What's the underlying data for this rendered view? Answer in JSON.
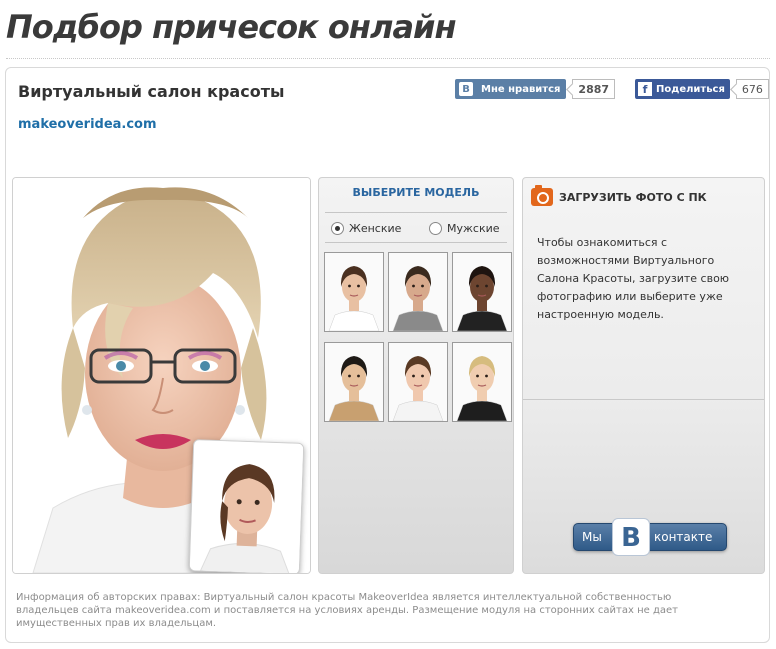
{
  "page": {
    "title": "Подбор причесок онлайн"
  },
  "header": {
    "app_title": "Виртуальный салон красоты",
    "site_link": "makeoveridea.com",
    "vk_like": {
      "logo": "B",
      "label": "Мне нравится",
      "count": "2887"
    },
    "fb_share": {
      "logo": "f",
      "label": "Поделиться",
      "count": "676"
    }
  },
  "model_selector": {
    "heading": "ВЫБЕРИТЕ МОДЕЛЬ",
    "options": [
      {
        "label": "Женские",
        "selected": true
      },
      {
        "label": "Мужские",
        "selected": false
      }
    ],
    "thumbnails": [
      {
        "skin": "#e8c0a2",
        "hair": "#4a3020",
        "clothes": "#ffffff"
      },
      {
        "skin": "#d7a98c",
        "hair": "#3a2a1e",
        "clothes": "#8a8a8a"
      },
      {
        "skin": "#6d4530",
        "hair": "#1e1410",
        "clothes": "#222222"
      },
      {
        "skin": "#e5bf9a",
        "hair": "#1e1a16",
        "clothes": "#c8a070"
      },
      {
        "skin": "#f0c8ae",
        "hair": "#5a3a24",
        "clothes": "#f4f4f4"
      },
      {
        "skin": "#f0cdb0",
        "hair": "#d6bc7e",
        "clothes": "#1e1e1e"
      }
    ]
  },
  "upload": {
    "heading": "ЗАГРУЗИТЬ ФОТО С ПК",
    "icon": "camera-icon",
    "description": "Чтобы ознакомиться с возможностями Виртуального Салона Красоты, загрузите свою фотографию или выберите уже настроенную модель.",
    "vk_badge": {
      "left": "Мы",
      "letter": "B",
      "right": "контакте"
    }
  },
  "footer": {
    "copyright": "Информация об авторских правах: Виртуальный салон красоты MakeoverIdea является интеллектуальной собственностью владельцев сайта makeoveridea.com и поставляется на условиях аренды. Размещение модуля на сторонних сайтах не дает имущественных прав их владельцам."
  },
  "colors": {
    "link": "#1f6fa8",
    "vk": "#5b7fa6",
    "facebook": "#3b5998",
    "camera": "#e2671c"
  }
}
